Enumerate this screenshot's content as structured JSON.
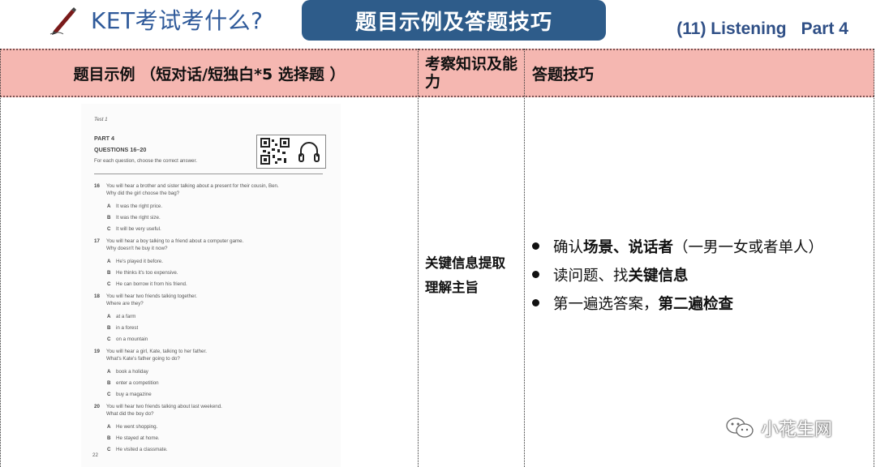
{
  "header": {
    "title": "KET考试考什么?",
    "banner": "题目示例及答题技巧",
    "section_number": "(11) Listening",
    "part_label": "Part 4"
  },
  "table": {
    "headers": [
      "题目示例 （短对话/短独白*5 选择题 ）",
      "考察知识及能力",
      "答题技巧"
    ],
    "knowledge": [
      "关键信息提取",
      "理解主旨"
    ],
    "tips": [
      {
        "parts": [
          {
            "t": "确认",
            "b": false
          },
          {
            "t": "场景、说话者",
            "b": true
          },
          {
            "t": "（一男一女或者单人）",
            "b": false
          }
        ]
      },
      {
        "parts": [
          {
            "t": "读问题、找",
            "b": false
          },
          {
            "t": "关键信息",
            "b": true
          }
        ]
      },
      {
        "parts": [
          {
            "t": "第一遍选答案，",
            "b": false
          },
          {
            "t": "第二遍检查",
            "b": true
          }
        ]
      }
    ]
  },
  "scan": {
    "test_label": "Test 1",
    "part": "PART 4",
    "questions_range": "QUESTIONS 16–20",
    "instruction": "For each question, choose the correct answer.",
    "questions": [
      {
        "num": "16",
        "prompt": "You will hear a brother and sister talking about a present for their cousin, Ben.",
        "question": "Why did the girl choose the bag?",
        "options": [
          {
            "l": "A",
            "t": "It was the right price."
          },
          {
            "l": "B",
            "t": "It was the right size."
          },
          {
            "l": "C",
            "t": "It will be very useful."
          }
        ]
      },
      {
        "num": "17",
        "prompt": "You will hear a boy talking to a friend about a computer game.",
        "question": "Why doesn't he buy it now?",
        "options": [
          {
            "l": "A",
            "t": "He's played it before."
          },
          {
            "l": "B",
            "t": "He thinks it's too expensive."
          },
          {
            "l": "C",
            "t": "He can borrow it from his friend."
          }
        ]
      },
      {
        "num": "18",
        "prompt": "You will hear two friends talking together.",
        "question": "Where are they?",
        "options": [
          {
            "l": "A",
            "t": "at a farm"
          },
          {
            "l": "B",
            "t": "in a forest"
          },
          {
            "l": "C",
            "t": "on a mountain"
          }
        ]
      },
      {
        "num": "19",
        "prompt": "You will hear a girl, Kate, talking to her father.",
        "question": "What's Kate's father going to do?",
        "options": [
          {
            "l": "A",
            "t": "book a holiday"
          },
          {
            "l": "B",
            "t": "enter a competition"
          },
          {
            "l": "C",
            "t": "buy a magazine"
          }
        ]
      },
      {
        "num": "20",
        "prompt": "You will hear two friends talking about last weekend.",
        "question": "What did the boy do?",
        "options": [
          {
            "l": "A",
            "t": "He went shopping."
          },
          {
            "l": "B",
            "t": "He stayed at home."
          },
          {
            "l": "C",
            "t": "He visited a classmate."
          }
        ]
      }
    ],
    "page_number": "22"
  },
  "watermark": "小花生网",
  "icons": {
    "pen": "pen-icon",
    "qr": "qr-code-icon",
    "headphones": "headphones-icon",
    "wechat": "wechat-icon"
  }
}
